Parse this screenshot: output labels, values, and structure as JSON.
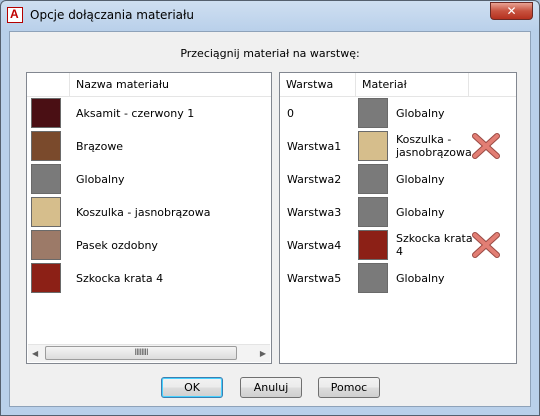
{
  "window": {
    "title": "Opcje dołączania materiału",
    "close_glyph": "✕",
    "app_icon_letter": "A"
  },
  "instruction": "Przeciągnij materiał na warstwę:",
  "materials": {
    "header": "Nazwa materiału",
    "items": [
      {
        "name": "Aksamit - czerwony 1",
        "color": "#4a0f14"
      },
      {
        "name": "Brązowe",
        "color": "#7a4a2c"
      },
      {
        "name": "Globalny",
        "color": "#7a7a7a"
      },
      {
        "name": "Koszulka - jasnobrązowa",
        "color": "#d6be8c"
      },
      {
        "name": "Pasek ozdobny",
        "color": "#9c7a68"
      },
      {
        "name": "Szkocka krata 4",
        "color": "#8c2016"
      }
    ],
    "scroll_grip": "IIIIIIII"
  },
  "layers": {
    "header_layer": "Warstwa",
    "header_material": "Materiał",
    "rows": [
      {
        "layer": "0",
        "material": "Globalny",
        "color": "#7a7a7a",
        "removable": false
      },
      {
        "layer": "Warstwa1",
        "material": "Koszulka - jasnobrązowa",
        "material_line1": "Koszulka -",
        "material_line2": "jasnobrązowa",
        "color": "#d6be8c",
        "removable": true
      },
      {
        "layer": "Warstwa2",
        "material": "Globalny",
        "color": "#7a7a7a",
        "removable": false
      },
      {
        "layer": "Warstwa3",
        "material": "Globalny",
        "color": "#7a7a7a",
        "removable": false
      },
      {
        "layer": "Warstwa4",
        "material": "Szkocka krata 4",
        "material_line1": "Szkocka krata",
        "material_line2": "4",
        "color": "#8c2016",
        "removable": true
      },
      {
        "layer": "Warstwa5",
        "material": "Globalny",
        "color": "#7a7a7a",
        "removable": false
      }
    ]
  },
  "buttons": {
    "ok": "OK",
    "cancel": "Anuluj",
    "help": "Pomoc"
  }
}
